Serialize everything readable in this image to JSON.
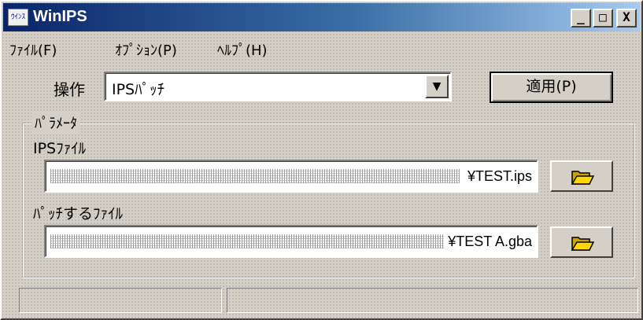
{
  "window": {
    "title": "WinIPS",
    "icon_text": "ｳｲﾝｽ",
    "minimize_glyph": "_",
    "maximize_glyph": "□",
    "close_glyph": "X"
  },
  "menu": {
    "items": [
      {
        "label": "ﾌｧｲﾙ(F)"
      },
      {
        "label": "ｵﾌﾟｼｮﾝ(P)"
      },
      {
        "label": "ﾍﾙﾌﾟ(H)"
      }
    ]
  },
  "operation": {
    "label": "操作",
    "selected": "IPSﾊﾟｯﾁ",
    "dropdown_glyph": "▼"
  },
  "apply_button": {
    "label": "適用(P)"
  },
  "params": {
    "legend": "ﾊﾟﾗﾒｰﾀ",
    "ips_file": {
      "label": "IPSﾌｧｲﾙ",
      "value_suffix": "¥TEST.ips"
    },
    "target_file": {
      "label": "ﾊﾟｯﾁするﾌｧｲﾙ",
      "value_suffix": "¥TEST A.gba"
    }
  },
  "icons": {
    "app": "app-icon",
    "browse": "open-folder-icon"
  },
  "colors": {
    "titlebar_start": "#0a246a",
    "titlebar_end": "#a6caf0",
    "face": "#d4d0c8"
  }
}
